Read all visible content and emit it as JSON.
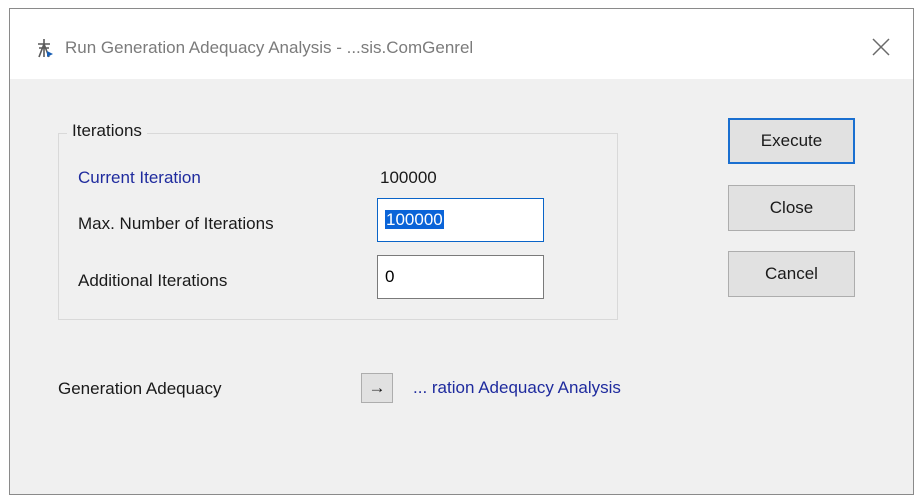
{
  "window": {
    "title": "Run Generation Adequacy Analysis - ...sis.ComGenrel",
    "icon": "tower-icon"
  },
  "iterations": {
    "group_label": "Iterations",
    "current_label": "Current Iteration",
    "current_value": "100000",
    "max_label": "Max. Number of Iterations",
    "max_value": "100000",
    "additional_label": "Additional Iterations",
    "additional_value": "0"
  },
  "buttons": {
    "execute": "Execute",
    "close": "Close",
    "cancel": "Cancel"
  },
  "adequacy": {
    "label": "Generation Adequacy",
    "arrow": "→",
    "link_text": "... ration Adequacy Analysis"
  },
  "colors": {
    "link": "#1f2b9e",
    "focus_border": "#1a6fd0",
    "selection": "#0a64d8"
  }
}
